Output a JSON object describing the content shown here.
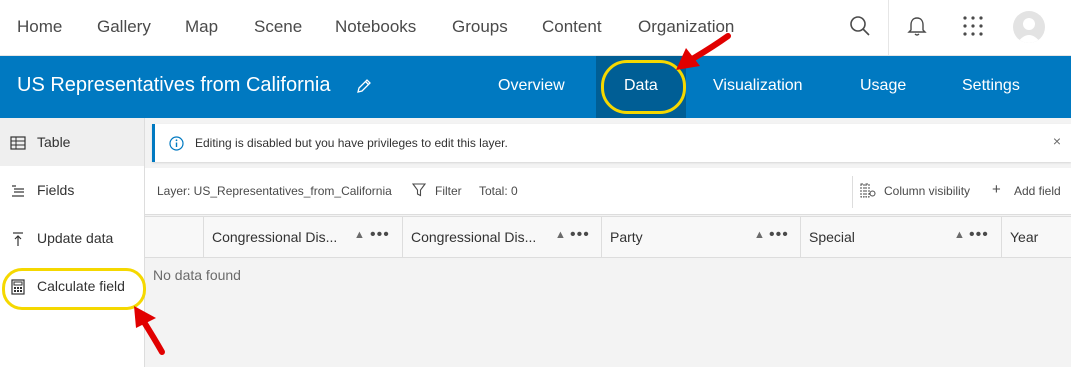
{
  "topnav": {
    "items": [
      "Home",
      "Gallery",
      "Map",
      "Scene",
      "Notebooks",
      "Groups",
      "Content",
      "Organization"
    ],
    "icons": {
      "search": "search-icon",
      "notifications": "bell-icon",
      "apps": "app-grid-icon",
      "avatar": "user-avatar"
    }
  },
  "header": {
    "title": "US Representatives from California",
    "tabs": [
      "Overview",
      "Data",
      "Visualization",
      "Usage",
      "Settings"
    ],
    "active_tab": "Data",
    "accent": "#0079c1",
    "active_bg": "#005e95"
  },
  "sidebar": {
    "items": [
      {
        "label": "Table",
        "icon": "table-icon",
        "active": true
      },
      {
        "label": "Fields",
        "icon": "fields-list-icon"
      },
      {
        "label": "Update data",
        "icon": "upload-icon"
      },
      {
        "label": "Calculate field",
        "icon": "calculator-icon"
      }
    ]
  },
  "notice": {
    "message": "Editing is disabled but you have privileges to edit this layer.",
    "close": "×"
  },
  "toolbar": {
    "layer_label": "Layer: US_Representatives_from_California",
    "filter_label": "Filter",
    "total_label": "Total: 0",
    "column_visibility_label": "Column visibility",
    "add_field_label": "Add field"
  },
  "table": {
    "columns": [
      "Congressional Dis...",
      "Congressional Dis...",
      "Party",
      "Special",
      "Year"
    ],
    "empty_text": "No data found"
  },
  "annotations": {
    "highlight_color": "#f5d800",
    "arrow_color": "#e10000"
  }
}
